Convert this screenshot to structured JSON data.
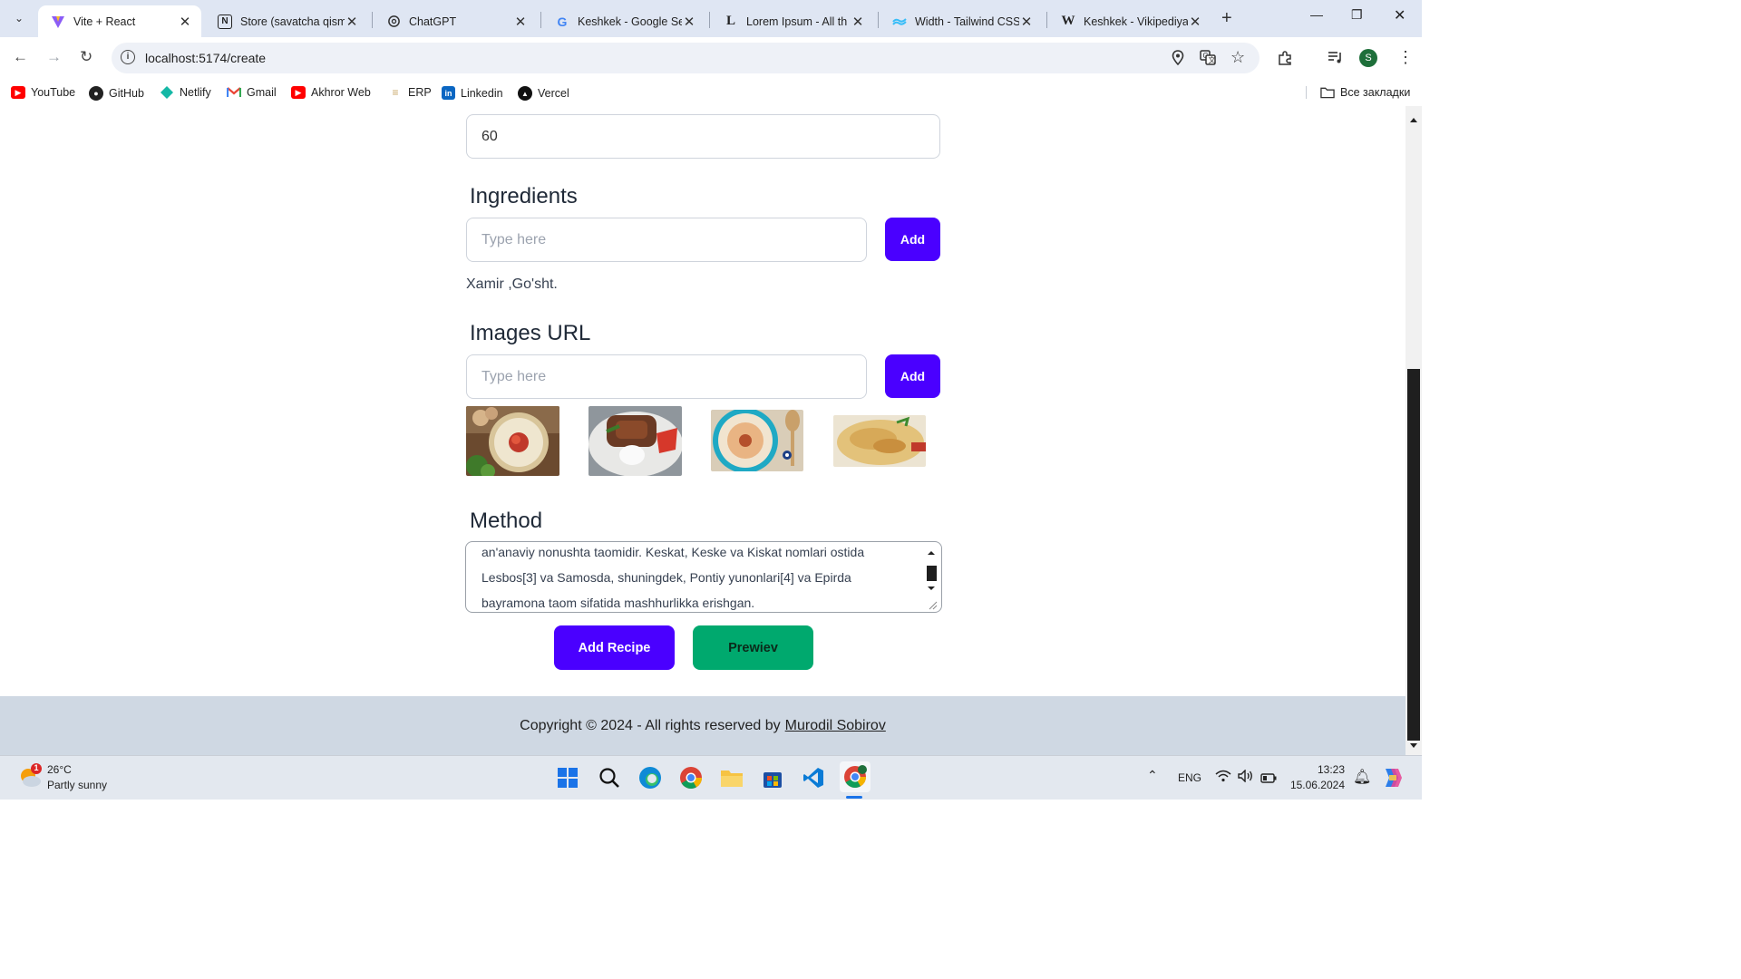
{
  "browser": {
    "tabs": [
      {
        "title": "Vite + React",
        "active": true,
        "favicon": "vite-icon"
      },
      {
        "title": "Store (savatcha qismi",
        "favicon": "notion-icon"
      },
      {
        "title": "ChatGPT",
        "favicon": "chatgpt-icon"
      },
      {
        "title": "Keshkek - Google Se",
        "favicon": "google-icon"
      },
      {
        "title": "Lorem Ipsum - All th",
        "favicon": "lorem-icon"
      },
      {
        "title": "Width - Tailwind CSS",
        "favicon": "tailwind-icon"
      },
      {
        "title": "Keshkek - Vikipediya",
        "favicon": "wikipedia-icon"
      }
    ],
    "url": "localhost:5174/create",
    "profile_initial": "S",
    "bookmarks": [
      {
        "label": "YouTube",
        "icon": "youtube-icon"
      },
      {
        "label": "GitHub",
        "icon": "github-icon"
      },
      {
        "label": "Netlify",
        "icon": "netlify-icon"
      },
      {
        "label": "Gmail",
        "icon": "gmail-icon"
      },
      {
        "label": "Akhror Web",
        "icon": "youtube-icon"
      },
      {
        "label": "ERP",
        "icon": "erp-icon"
      },
      {
        "label": "Linkedin",
        "icon": "linkedin-icon"
      },
      {
        "label": "Vercel",
        "icon": "vercel-icon"
      }
    ],
    "all_bookmarks_label": "Все закладки"
  },
  "form": {
    "cooking_time_value": "60",
    "ingredients": {
      "label": "Ingredients",
      "placeholder": "Type here",
      "add_label": "Add",
      "list_text": "Xamir ,Go'sht."
    },
    "images": {
      "label": "Images URL",
      "placeholder": "Type here",
      "add_label": "Add"
    },
    "method": {
      "label": "Method",
      "lines": [
        "an'anaviy nonushta taomidir. Keskat, Keske va Kiskat nomlari ostida",
        "Lesbos[3] va Samosda, shuningdek, Pontiy yunonlari[4] va Epirda",
        "bayramona taom sifatida mashhurlikka erishgan."
      ]
    },
    "add_recipe_label": "Add Recipe",
    "preview_label": "Prewiev"
  },
  "footer": {
    "text": "Copyright © 2024 - All rights reserved by",
    "author": "Murodil Sobirov"
  },
  "taskbar": {
    "weather_temp": "26°C",
    "weather_desc": "Partly sunny",
    "weather_badge": "1",
    "lang": "ENG",
    "time": "13:23",
    "date": "15.06.2024"
  },
  "colors": {
    "primary": "#4a00ff",
    "secondary": "#00a96e",
    "footer_bg": "#cfd8e3"
  }
}
